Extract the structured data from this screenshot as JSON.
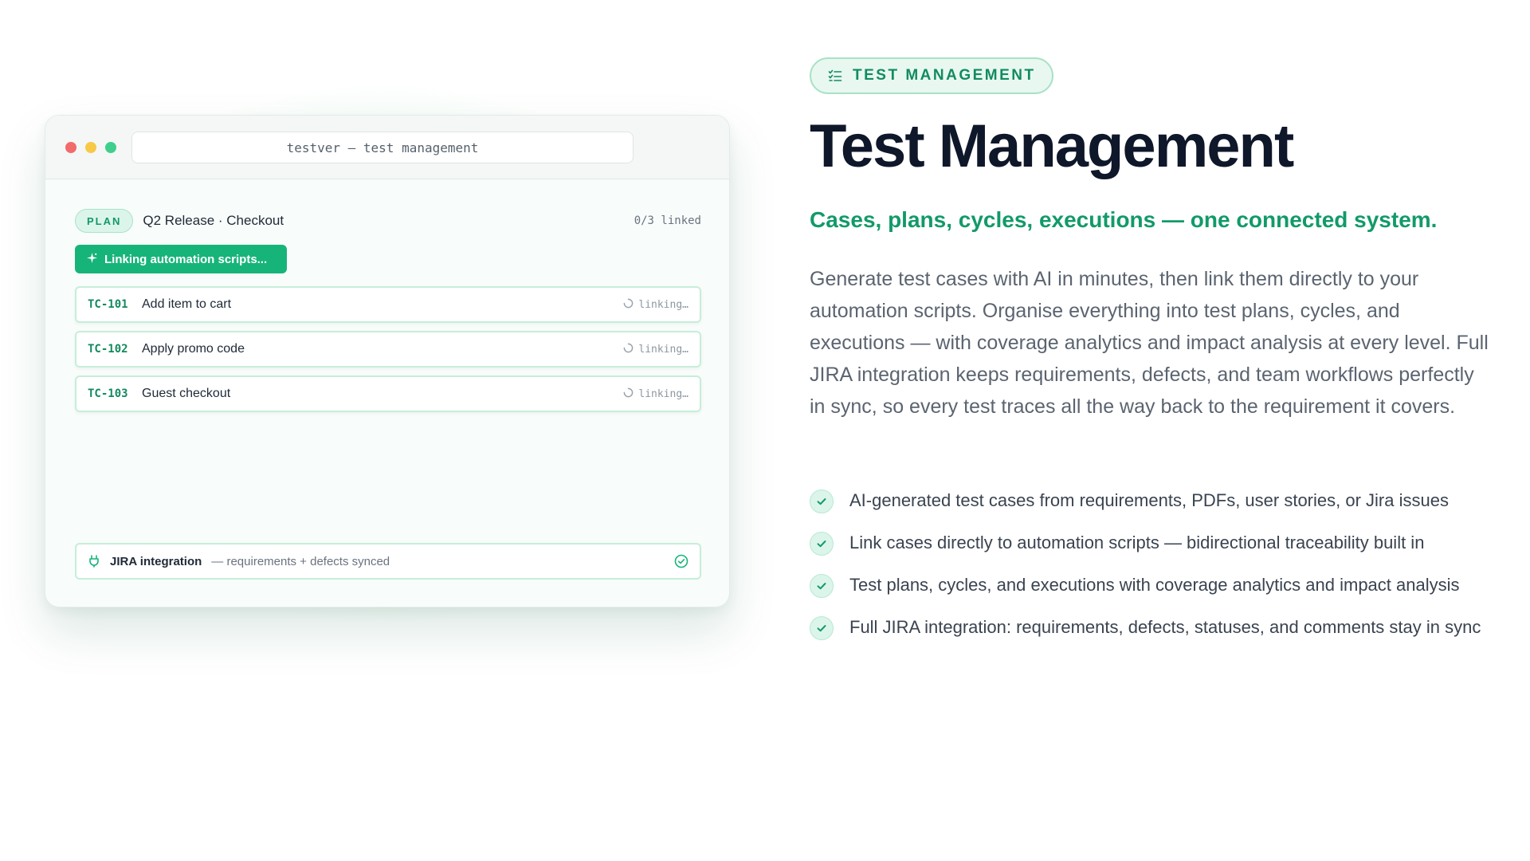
{
  "window": {
    "address": "testver — test management",
    "plan": {
      "badge": "PLAN",
      "name": "Q2 Release · Checkout",
      "linked_count": "0/3 linked"
    },
    "linking_button": "Linking automation scripts...",
    "cases": [
      {
        "id": "TC-101",
        "title": "Add item to cart",
        "status": "linking…"
      },
      {
        "id": "TC-102",
        "title": "Apply promo code",
        "status": "linking…"
      },
      {
        "id": "TC-103",
        "title": "Guest checkout",
        "status": "linking…"
      }
    ],
    "jira": {
      "label": "JIRA integration",
      "sub": "— requirements + defects synced"
    }
  },
  "section": {
    "pill": "TEST MANAGEMENT",
    "heading": "Test Management",
    "tagline": "Cases, plans, cycles, executions — one connected system.",
    "description": "Generate test cases with AI in minutes, then link them directly to your automation scripts. Organise everything into test plans, cycles, and executions — with coverage analytics and impact analysis at every level. Full JIRA integration keeps requirements, defects, and team workflows perfectly in sync, so every test traces all the way back to the requirement it covers.",
    "features": [
      "AI-generated test cases from requirements, PDFs, user stories, or Jira issues",
      "Link cases directly to automation scripts — bidirectional traceability built in",
      "Test plans, cycles, and executions with coverage analytics and impact analysis",
      "Full JIRA integration: requirements, defects, statuses, and comments stay in sync"
    ]
  },
  "colors": {
    "accent": "#17b47a",
    "accent_text": "#129a69",
    "heading": "#0f172a",
    "body_text": "#5b6470",
    "mac_red": "#f26a6a",
    "mac_yellow": "#f7c947",
    "mac_green": "#3fcf8c"
  },
  "icons": {
    "pill": "checklist-icon",
    "linking_button": "sparkle-icon",
    "case_status": "spinner-icon",
    "jira": "plug-icon",
    "jira_status": "check-circle-icon",
    "feature": "check-icon"
  }
}
